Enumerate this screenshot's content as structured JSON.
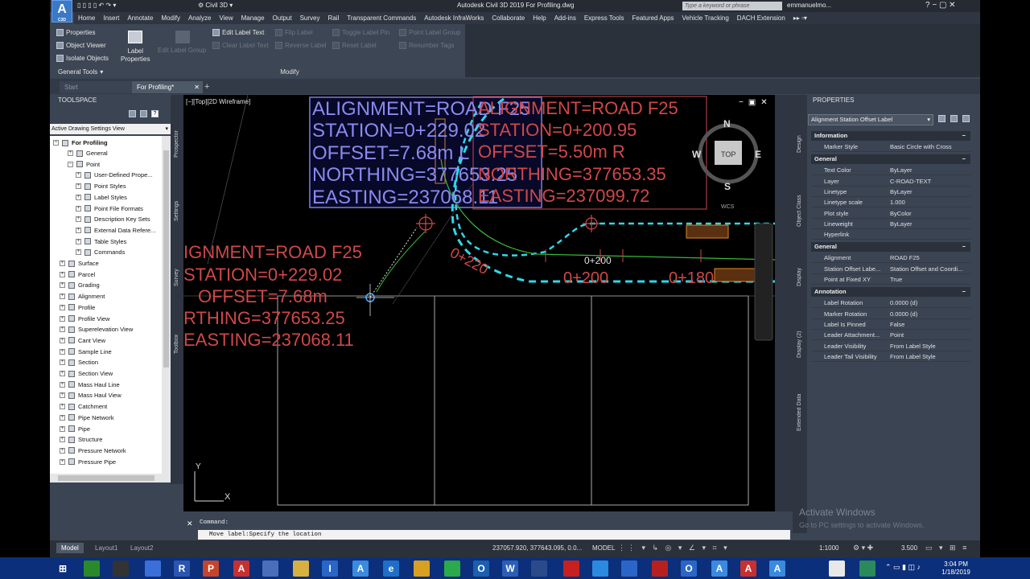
{
  "app": {
    "logo_letter": "A",
    "logo_sub": "C3D",
    "workspace": "Civil 3D",
    "title": "Autodesk Civil 3D 2019    For Profiling.dwg",
    "search_placeholder": "Type a keyword or phrase",
    "user": "emmanuelmo..."
  },
  "menu": [
    "Home",
    "Insert",
    "Annotate",
    "Modify",
    "Analyze",
    "View",
    "Manage",
    "Output",
    "Survey",
    "Rail",
    "Transparent Commands",
    "Autodesk InfraWorks",
    "Collaborate",
    "Help",
    "Add-ins",
    "Express Tools",
    "Featured Apps",
    "Vehicle Tracking",
    "DACH Extension"
  ],
  "ribbon": {
    "properties": "Properties",
    "object_viewer": "Object Viewer",
    "isolate_objects": "Isolate Objects",
    "general_tools": "General Tools",
    "label_properties_1": "Label",
    "label_properties_2": "Properties",
    "edit_label_text": "Edit Label Text",
    "flip_label": "Flip Label",
    "toggle_label_pin": "Toggle Label Pin",
    "point_label_group": "Point Label Group",
    "clear_label_text": "Clear Label Text",
    "reverse_label": "Reverse Label",
    "reset_label": "Reset Label",
    "renumber_tags": "Renumber Tags",
    "edit_label_group": "Edit Label Group",
    "modify_panel": "Modify"
  },
  "tabs": {
    "start": "Start",
    "for_profiling": "For Profiling*"
  },
  "toolspace": {
    "title": "TOOLSPACE",
    "view": "Active Drawing Settings View",
    "root": "For Profiling",
    "items": [
      "General",
      "Point",
      "User-Defined Prope...",
      "Point Styles",
      "Label Styles",
      "Point File Formats",
      "Description Key Sets",
      "External Data Refere...",
      "Table Styles",
      "Commands",
      "Surface",
      "Parcel",
      "Grading",
      "Alignment",
      "Profile",
      "Profile View",
      "Superelevation View",
      "Cant View",
      "Sample Line",
      "Section",
      "Section View",
      "Mass Haul Line",
      "Mass Haul View",
      "Catchment",
      "Pipe Network",
      "Pipe",
      "Structure",
      "Pressure Network",
      "Pressure Pipe"
    ],
    "side_tabs": [
      "Prospector",
      "Settings",
      "Survey",
      "Toolbox"
    ]
  },
  "viewport": {
    "label": "[−][Top][2D Wireframe]",
    "label_a": [
      "ALIGNMENT=ROAD F25",
      "STATION=0+229.02",
      "OFFSET=7.68m L",
      "NORTHING=377653.25",
      "EASTING=237068.11"
    ],
    "label_b": [
      "ALIGNMENT=ROAD F25",
      "STATION=0+200.95",
      "OFFSET=5.50m  R",
      "NORTHING=377653.35",
      "EASTING=237099.72"
    ],
    "label_c": [
      "IGNMENT=ROAD F25",
      "STATION=0+229.02",
      "OFFSET=7.68m",
      "RTHING=377653.25",
      "EASTING=237068.11"
    ],
    "station_small": "0+200",
    "station_1": "0+200",
    "station_2": "0+180",
    "station_diag": "0+220",
    "compass": {
      "n": "N",
      "s": "S",
      "e": "E",
      "w": "W",
      "top": "TOP",
      "wcs": "WCS"
    },
    "ucs_y": "Y",
    "ucs_x": "X"
  },
  "properties": {
    "title": "PROPERTIES",
    "selected": "Alignment Station Offset Label",
    "tabs": [
      "Design",
      "Object Class",
      "Display",
      "Display (2)",
      "Extended Data"
    ],
    "sections": [
      {
        "name": "Information",
        "rows": [
          [
            "Marker Style",
            "Basic Circle with Cross"
          ]
        ]
      },
      {
        "name": "General",
        "rows": [
          [
            "Text Color",
            "ByLayer"
          ],
          [
            "Layer",
            "C-ROAD-TEXT"
          ],
          [
            "Linetype",
            "ByLayer"
          ],
          [
            "Linetype scale",
            "1.000"
          ],
          [
            "Plot style",
            "ByColor"
          ],
          [
            "Lineweight",
            "ByLayer"
          ],
          [
            "Hyperlink",
            ""
          ]
        ]
      },
      {
        "name": "General",
        "rows": [
          [
            "Alignment",
            "ROAD F25"
          ],
          [
            "Station Offset Labe...",
            "Station Offset and Coordi..."
          ],
          [
            "Point at Fixed XY",
            "True"
          ]
        ]
      },
      {
        "name": "Annotation",
        "rows": [
          [
            "Label Rotation",
            "0.0000 (d)"
          ],
          [
            "Marker Rotation",
            "0.0000 (d)"
          ],
          [
            "Label Is Pinned",
            "False"
          ],
          [
            "Leader Attachment...",
            "Point"
          ],
          [
            "Leader Visibility",
            "From Label Style"
          ],
          [
            "Leader Tail Visibility",
            "From Label Style"
          ]
        ]
      }
    ]
  },
  "command": {
    "label": "Command:",
    "text": "Move label:Specify the location"
  },
  "watermark": {
    "line1": "Activate Windows",
    "line2": "Go to PC settings to activate Windows."
  },
  "status": {
    "model_tab": "Model",
    "layout1": "Layout1",
    "layout2": "Layout2",
    "coords": "237057.920, 377643.095, 0.0...",
    "model": "MODEL",
    "scale": "1:1000",
    "anno": "3.500"
  },
  "taskbar": {
    "time": "3:04 PM",
    "date": "1/18/2019"
  },
  "colors": {
    "label_blue": "#8a8af0",
    "label_red": "#d04848",
    "alignment_cyan": "#30d8e8",
    "offset_green": "#38b838"
  }
}
